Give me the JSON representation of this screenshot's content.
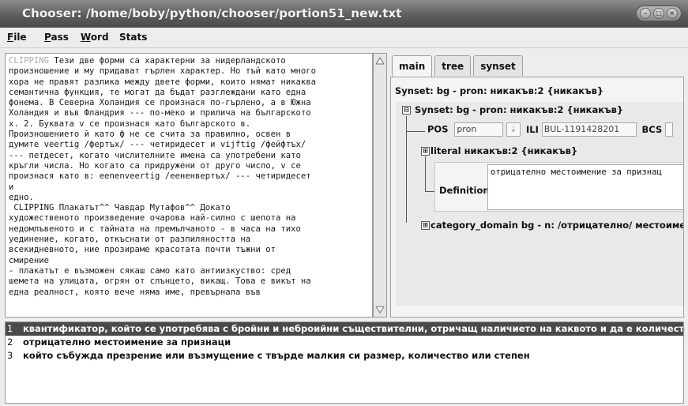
{
  "window": {
    "title": "Chooser: /home/boby/python/chooser/portion51_new.txt"
  },
  "menu": {
    "items": [
      {
        "label": "File",
        "mnemonic": "F"
      },
      {
        "label": "Pass",
        "mnemonic": "P"
      },
      {
        "label": "Word",
        "mnemonic": "W"
      },
      {
        "label": "Stats",
        "mnemonic": ""
      }
    ]
  },
  "left_text": {
    "lines": [
      {
        "prefix": "CLIPPING",
        "text": " Тези две форми са характерни за нидерландското"
      },
      {
        "prefix": "",
        "text": "произношение и му придават гърлен характер. Но тъй като много"
      },
      {
        "prefix": "",
        "text": "хора не правят разлика между двете форми, които нямат никаква"
      },
      {
        "prefix": "",
        "text": "семантична функция, те могат да бъдат разглеждани като една"
      },
      {
        "prefix": "",
        "text": "фонема. В Северна Холандия се произнася по-гърлено, а в Южна"
      },
      {
        "prefix": "",
        "text": "Холандия и във Фландрия --- по-меко и прилича на българското"
      },
      {
        "prefix": "",
        "text": "х. 2. Буквата v се произнася като българското в."
      },
      {
        "prefix": "",
        "text": "Произношението й като ф не се счита за правилно, освен в"
      },
      {
        "prefix": "",
        "text": "думите veertig /фертъх/ --- четиридесет и vijftig /фейфтъх/"
      },
      {
        "prefix": "",
        "text": "--- петдесет, когато числителните имена са употребени като"
      },
      {
        "prefix": "",
        "text": "кръгли числа. Но когато са придружени от друго число, v се"
      },
      {
        "prefix": "",
        "text": "произнася като в: eenenveertig /еененвертъх/ --- четиридесет"
      },
      {
        "prefix": "",
        "text": "и"
      },
      {
        "prefix": "",
        "text": "едно."
      },
      {
        "prefix": "",
        "text": ""
      },
      {
        "prefix": "",
        "text": " CLIPPING Плакатът^^ Чавдар Мутафов^^ Докато"
      },
      {
        "prefix": "",
        "text": "художественото произведение очарова най-силно с шепота на"
      },
      {
        "prefix": "",
        "text": "недомлъвеното и с тайната на премълчаното - в часа на тихо"
      },
      {
        "prefix": "",
        "text": "уединение, когато, откъснати от разпиляността на"
      },
      {
        "prefix": "",
        "text": "всекидневното, ние прозираме красотата почти тъжни от"
      },
      {
        "prefix": "",
        "text": "смирение"
      },
      {
        "prefix": "",
        "text": "- плакатът е възможен сякаш само като антиизкуство: сред"
      },
      {
        "prefix": "",
        "text": "шемета на улицата, огрян от слънцето, викащ. Това е викът на"
      },
      {
        "prefix": "",
        "text": "една реалност, която вече няма име, превърнала във"
      }
    ]
  },
  "tabs": [
    {
      "label": "main",
      "active": true
    },
    {
      "label": "tree",
      "active": false
    },
    {
      "label": "synset",
      "active": false
    }
  ],
  "main": {
    "synset_header": "Synset: bg - pron: никакъв:2 {никакъв}",
    "tree_root": "Synset: bg - pron: никакъв:2 {никакъв}",
    "tree_root_toggle": "⊟",
    "pos_label": "POS",
    "pos_value": "pron",
    "ili_label": "ILI",
    "ili_value": "BUL-1191428201",
    "bcs_label": "BCS",
    "literal_toggle": "⊞",
    "literal_label": "literal",
    "literal_value": "никакъв:2 {никакъв}",
    "definition_label": "Definition",
    "definition_text": "отрицателно местоимение за признац",
    "category_toggle": "⊞",
    "category_label": "category_domain bg - n: /отрицателно/ местоимени"
  },
  "candidates": [
    {
      "num": "1",
      "text": "квантификатор, който се употребява с бройни и неброийни съществителни, отричащ наличието на каквото и да е количество",
      "selected": true
    },
    {
      "num": "2",
      "text": "отрицателно местоимение за признаци",
      "selected": false
    },
    {
      "num": "3",
      "text": "който събужда презрение или възмущение с твърде малкия си размер, количество или степен",
      "selected": false
    }
  ],
  "colors": {
    "selection_bg": "#4a4a4a",
    "clipping_text": "#a8a8a8"
  }
}
